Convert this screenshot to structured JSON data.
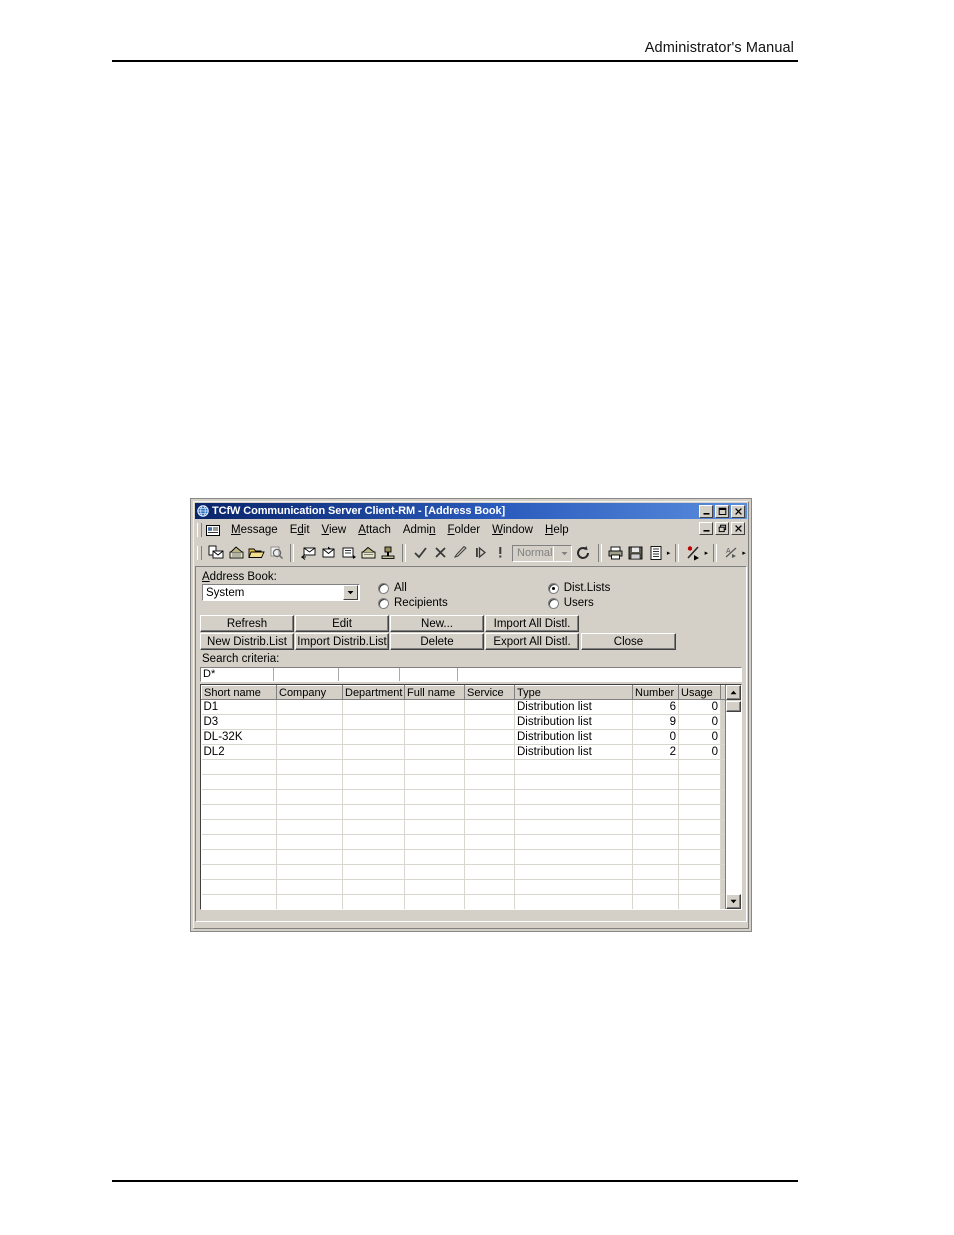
{
  "page": {
    "header_title": "Administrator's Manual"
  },
  "window": {
    "title": "TCfW Communication Server Client-RM - [Address Book]",
    "icon": "globe-icon",
    "controls": [
      {
        "name": "minimize",
        "glyph": "_"
      },
      {
        "name": "maximize",
        "glyph": "□"
      },
      {
        "name": "close",
        "glyph": "✕"
      }
    ],
    "mdi_controls": [
      {
        "name": "minimize",
        "glyph": "_"
      },
      {
        "name": "restore",
        "glyph": "⧉"
      },
      {
        "name": "close",
        "glyph": "✕"
      }
    ]
  },
  "menubar": {
    "items": [
      {
        "label": "Message",
        "accel": "M"
      },
      {
        "label": "Edit",
        "accel": "d"
      },
      {
        "label": "View",
        "accel": "V"
      },
      {
        "label": "Attach",
        "accel": "A"
      },
      {
        "label": "Admin",
        "accel": "n"
      },
      {
        "label": "Folder",
        "accel": "F"
      },
      {
        "label": "Window",
        "accel": "W"
      },
      {
        "label": "Help",
        "accel": "H"
      }
    ]
  },
  "toolbar": {
    "priority_value": "Normal",
    "icons": [
      "new-message-icon",
      "new-address-icon",
      "open-folder-icon",
      "find-icon",
      "reply-icon",
      "reply-all-icon",
      "forward-icon",
      "address-book-icon",
      "send-icon",
      "check-icon",
      "delete-x-icon",
      "edit-pen-icon",
      "next-icon",
      "priority-icon",
      "refresh-icon",
      "print-icon",
      "save-icon",
      "properties-icon",
      "mark-read-icon",
      "signature-icon"
    ]
  },
  "form": {
    "address_book_label": "Address Book:",
    "address_book_value": "System",
    "filters": [
      {
        "label": "All",
        "selected": false
      },
      {
        "label": "Recipients",
        "selected": false
      },
      {
        "label": "Dist.Lists",
        "selected": true
      },
      {
        "label": "Users",
        "selected": false
      }
    ],
    "buttons_row1": [
      "Refresh",
      "Edit",
      "New...",
      "Import All Distl."
    ],
    "buttons_row2": [
      "New Distrib.List",
      "Import Distrib.List",
      "Delete",
      "Export All Distl."
    ],
    "close_button": "Close",
    "search_label": "Search criteria:",
    "search_values": [
      "D*",
      "",
      "",
      "",
      "",
      "",
      "",
      ""
    ]
  },
  "grid": {
    "columns": [
      "Short name",
      "Company",
      "Department",
      "Full name",
      "Service",
      "Type",
      "Number",
      "Usage"
    ],
    "rows": [
      {
        "short_name": "D1",
        "company": "",
        "department": "",
        "full_name": "",
        "service": "",
        "type": "Distribution list",
        "number": "6",
        "usage": "0"
      },
      {
        "short_name": "D3",
        "company": "",
        "department": "",
        "full_name": "",
        "service": "",
        "type": "Distribution list",
        "number": "9",
        "usage": "0"
      },
      {
        "short_name": "DL-32K",
        "company": "",
        "department": "",
        "full_name": "",
        "service": "",
        "type": "Distribution list",
        "number": "0",
        "usage": "0"
      },
      {
        "short_name": "DL2",
        "company": "",
        "department": "",
        "full_name": "",
        "service": "",
        "type": "Distribution list",
        "number": "2",
        "usage": "0"
      }
    ],
    "empty_row_count": 10
  },
  "colors": {
    "face": "#d4d0c8",
    "title_start": "#0a246a",
    "title_end": "#5a8ddd",
    "field": "#ffffff"
  }
}
